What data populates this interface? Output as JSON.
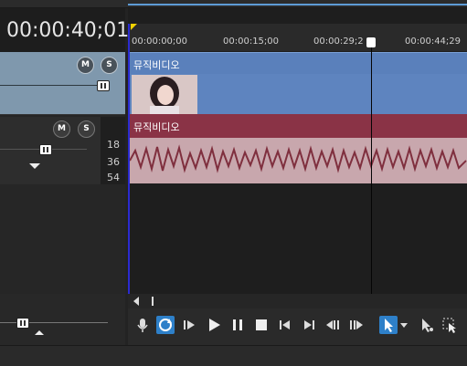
{
  "timecode": "00:00:40;01",
  "ruler": {
    "marks": [
      "00:00:00;00",
      "00:00:15;00",
      "00:00:29;2",
      "00:00:44;29"
    ]
  },
  "video_track": {
    "clip_label": "뮤직비디오"
  },
  "audio_track": {
    "clip_label": "뮤직비디오"
  },
  "audio_meter": {
    "labels": [
      "18",
      "36",
      "54"
    ]
  },
  "header_buttons": {
    "mute": "M",
    "solo": "S"
  },
  "icons": {
    "mic": "microphone-icon",
    "loop": "loop-icon",
    "play_from_start": "play-from-start-icon",
    "play": "play-icon",
    "pause": "pause-icon",
    "stop": "stop-icon",
    "prev": "previous-frame-icon",
    "next": "next-frame-icon",
    "prev_marker": "prev-marker-icon",
    "next_marker": "next-marker-icon",
    "edit_tool": "normal-edit-tool-icon",
    "envelope_tool": "envelope-tool-icon",
    "select_tool": "selection-tool-icon"
  },
  "colors": {
    "video_track": "#5e84bf",
    "audio_track": "#c8a7ad",
    "audio_title": "#8a3346",
    "video_header": "#7f98ad",
    "accent": "#2e80c9"
  }
}
